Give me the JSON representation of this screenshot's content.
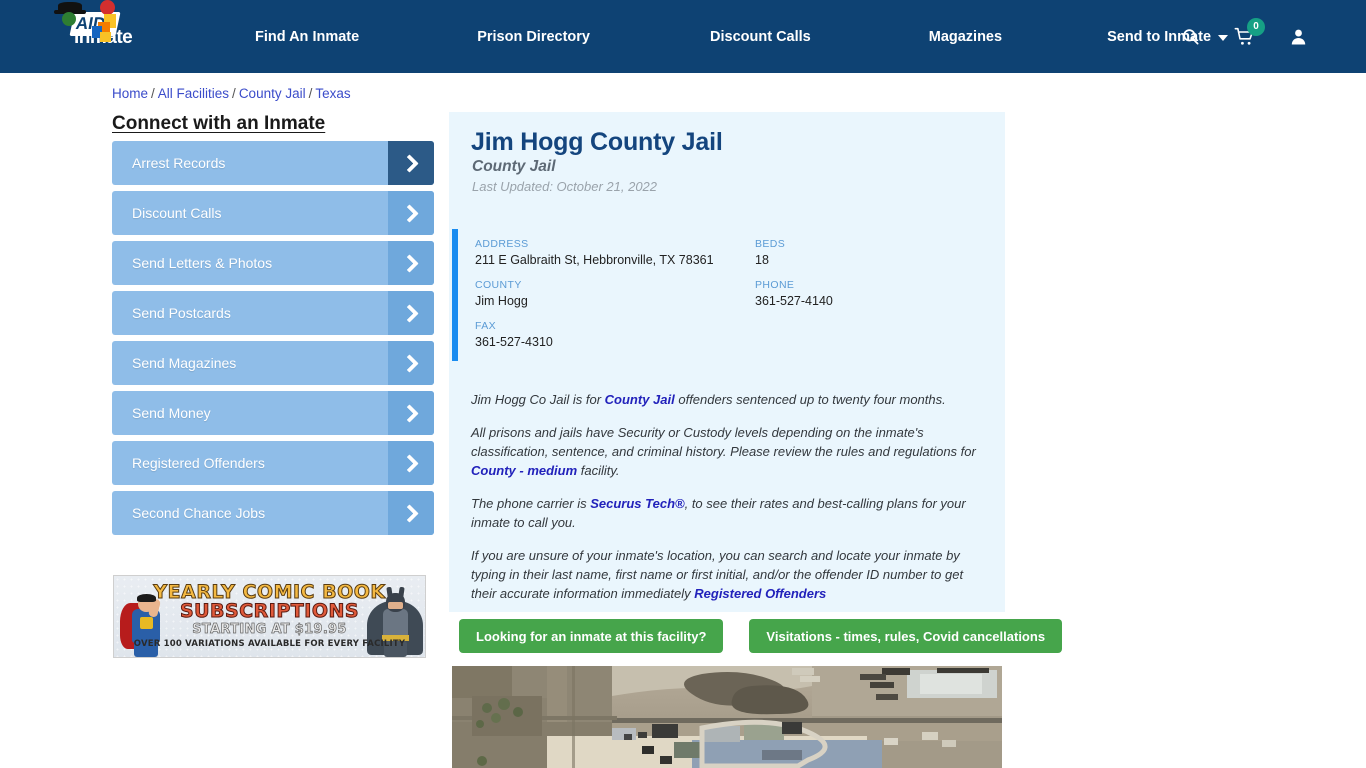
{
  "header": {
    "logo_word": "inmate",
    "logo_aid": "AID",
    "nav": [
      {
        "label": "Find An Inmate"
      },
      {
        "label": "Prison Directory"
      },
      {
        "label": "Discount Calls"
      },
      {
        "label": "Magazines"
      },
      {
        "label": "Send to Inmate"
      }
    ],
    "icons": {
      "search": "search-icon",
      "cart": "shopping-cart-icon",
      "cart_count": "0",
      "account": "user-account-icon"
    },
    "colors": {
      "header_bg": "#0e4273",
      "cart_badge": "#16a085"
    }
  },
  "breadcrumb": {
    "items": [
      "Home",
      "All Facilities",
      "County Jail",
      "Texas"
    ],
    "separator": "/"
  },
  "sidebar": {
    "title": "Connect with an Inmate",
    "items": [
      {
        "label": "Arrest Records"
      },
      {
        "label": "Discount Calls"
      },
      {
        "label": "Send Letters & Photos"
      },
      {
        "label": "Send Postcards"
      },
      {
        "label": "Send Magazines"
      },
      {
        "label": "Send Money"
      },
      {
        "label": "Registered Offenders"
      },
      {
        "label": "Second Chance Jobs"
      }
    ],
    "colors": {
      "button_bg": "#8fbde8",
      "arrow_bg": "#6fa8dc",
      "arrow_bg_active": "#2c5a87"
    }
  },
  "ad": {
    "line1": "YEARLY COMIC BOOK",
    "line2": "SUBSCRIPTIONS",
    "line3": "STARTING AT $19.95",
    "line4": "OVER 100 VARIATIONS AVAILABLE FOR EVERY FACILITY"
  },
  "facility": {
    "title": "Jim Hogg County Jail",
    "subtitle": "County Jail",
    "last_updated": "Last Updated: October 21, 2022",
    "fields": {
      "address_label": "ADDRESS",
      "address_value": "211 E Galbraith St, Hebbronville, TX 78361",
      "beds_label": "BEDS",
      "beds_value": "18",
      "county_label": "COUNTY",
      "county_value": "Jim Hogg",
      "phone_label": "PHONE",
      "phone_value": "361-527-4140",
      "fax_label": "FAX",
      "fax_value": "361-527-4310"
    },
    "paragraphs": {
      "p1_a": "Jim Hogg Co Jail is for ",
      "p1_link": "County Jail",
      "p1_b": " offenders sentenced up to twenty four months.",
      "p2_a": "All prisons and jails have Security or Custody levels depending on the inmate's classification, sentence, and criminal history. Please review the rules and regulations for ",
      "p2_link": "County - medium",
      "p2_b": " facility.",
      "p3_a": "The phone carrier is ",
      "p3_link": "Securus Tech®",
      "p3_b": ", to see their rates and best-calling plans for your inmate to call you.",
      "p4_a": "If you are unsure of your inmate's location, you can search and locate your inmate by typing in their last name, first name or first initial, and/or the offender ID number to get their accurate information immediately ",
      "p4_link": "Registered Offenders"
    },
    "accent_color": "#1a8cf0",
    "card_bg": "#eaf6fd"
  },
  "actions": {
    "inmate_search_label": "Looking for an inmate at this facility?",
    "visitation_label": "Visitations - times, rules, Covid cancellations",
    "button_color": "#46a54b"
  },
  "map": {
    "alt": "Aerial satellite view of Jim Hogg County Jail facility"
  }
}
